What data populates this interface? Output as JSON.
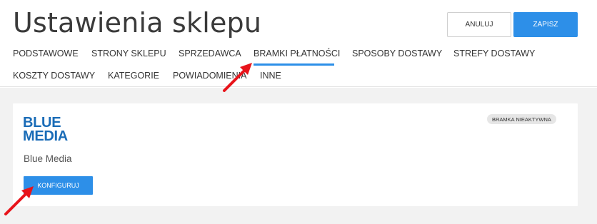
{
  "header": {
    "title": "Ustawienia sklepu",
    "cancel_label": "ANULUJ",
    "save_label": "ZAPISZ"
  },
  "tabs": [
    {
      "label": "PODSTAWOWE",
      "active": false
    },
    {
      "label": "STRONY SKLEPU",
      "active": false
    },
    {
      "label": "SPRZEDAWCA",
      "active": false
    },
    {
      "label": "BRAMKI PŁATNOŚCI",
      "active": true
    },
    {
      "label": "SPOSOBY DOSTAWY",
      "active": false
    },
    {
      "label": "STREFY DOSTAWY",
      "active": false
    },
    {
      "label": "KOSZTY DOSTAWY",
      "active": false
    },
    {
      "label": "KATEGORIE",
      "active": false
    },
    {
      "label": "POWIADOMIENIA",
      "active": false
    },
    {
      "label": "INNE",
      "active": false
    }
  ],
  "gateway": {
    "logo_line1": "BLUE",
    "logo_line2": "MEDIA",
    "name": "Blue Media",
    "status": "BRAMKA NIEAKTYWNA",
    "configure_label": "KONFIGURUJ"
  },
  "colors": {
    "accent": "#2d8fe8",
    "logo": "#1a6cb7",
    "arrow": "#e8141b"
  }
}
